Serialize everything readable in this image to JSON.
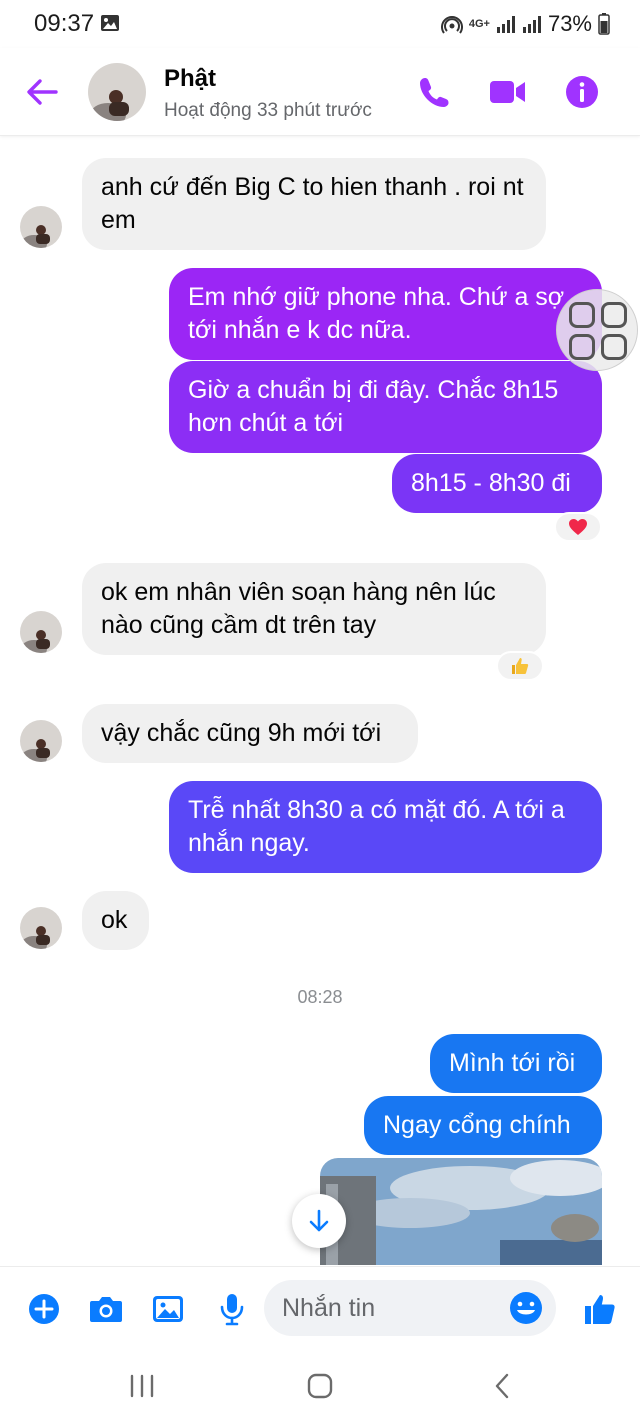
{
  "status_bar": {
    "time": "09:37",
    "network": "4G+",
    "battery": "73%"
  },
  "header": {
    "contact_name": "Phật",
    "activity": "Hoạt động 33 phút trước",
    "accent_color": "#a033ff"
  },
  "messages": [
    {
      "direction": "incoming",
      "text": "anh cứ đến Big C to hien thanh . roi nt em"
    },
    {
      "direction": "outgoing",
      "text": "Em nhớ giữ phone nha. Chứ a sợ tới nhắn e k dc nữa.",
      "color": "#9b26f5"
    },
    {
      "direction": "outgoing",
      "text": "Giờ a chuẩn bị đi đây. Chắc 8h15 hơn chút a tới",
      "color": "#8c2ef5"
    },
    {
      "direction": "outgoing",
      "text": "8h15 - 8h30 đi",
      "color": "#7b35f6",
      "reaction": "heart"
    },
    {
      "direction": "incoming",
      "text": "ok em nhân viên soạn hàng nên lúc nào cũng cầm dt trên tay",
      "reaction": "thumbs-up"
    },
    {
      "direction": "incoming",
      "text": "vậy chắc cũng 9h mới tới"
    },
    {
      "direction": "outgoing",
      "text": "Trễ nhất 8h30 a có mặt đó. A tới a nhắn ngay.",
      "color": "#5a48f7"
    },
    {
      "direction": "incoming",
      "text": "ok"
    },
    {
      "direction": "outgoing",
      "text": "Mình tới rồi",
      "color": "#1877f2"
    },
    {
      "direction": "outgoing",
      "text": "Ngay cổng chính",
      "color": "#1877f2"
    }
  ],
  "timestamp": "08:28",
  "composer": {
    "placeholder": "Nhắn tin",
    "icon_color": "#0a7cff"
  },
  "icons": {
    "back": "arrow-left-icon",
    "call": "phone-icon",
    "video": "video-camera-icon",
    "info": "info-icon",
    "add": "plus-circle-icon",
    "camera": "camera-icon",
    "gallery": "image-icon",
    "voice": "microphone-icon",
    "emoji": "smiley-icon",
    "like": "thumbs-up-icon",
    "scroll": "arrow-down-icon"
  }
}
